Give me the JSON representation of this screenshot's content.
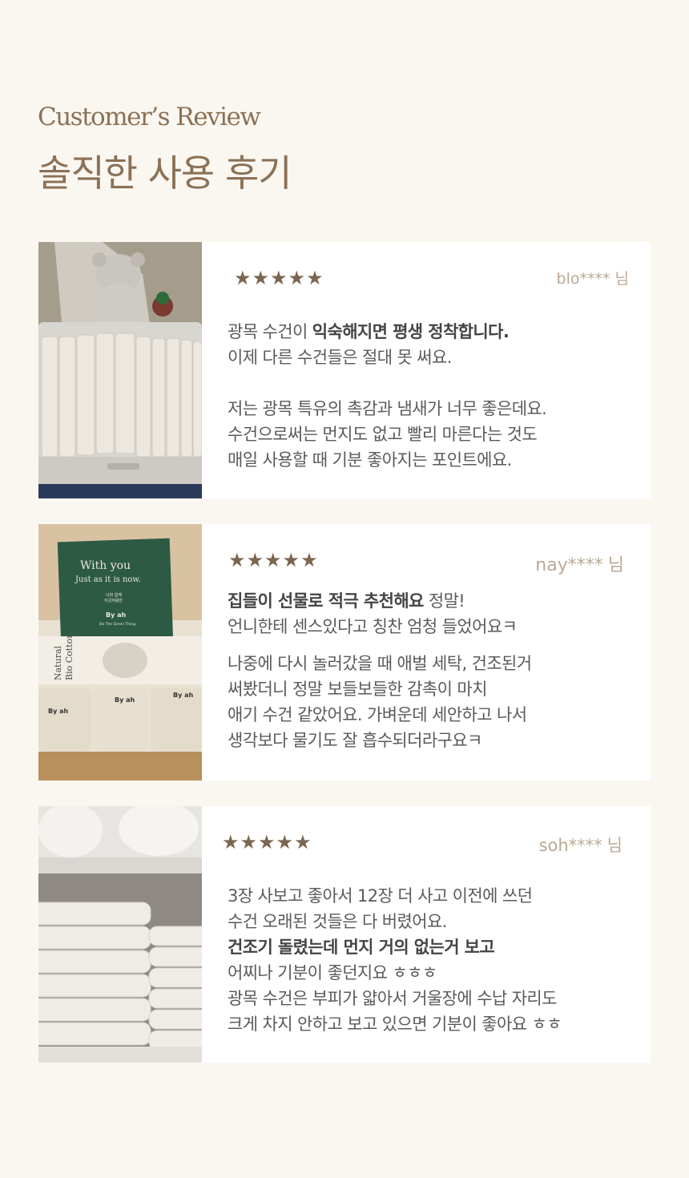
{
  "header": {
    "eyebrow": "Customer’s Review",
    "title": "솔직한 사용 후기"
  },
  "colors": {
    "accent": "#8b7155",
    "star": "#7c6650",
    "background": "#faf7f1"
  },
  "reviews": [
    {
      "stars": "★★★★★",
      "rating": 5,
      "user": "blo****",
      "suffix": "님",
      "lines": [
        {
          "bold": "광목 수건이 익숙해지면 평생 정착합니다.",
          "text": ""
        },
        {
          "text": "이제 다른 수건들은 절대 못 써요."
        },
        {
          "text": "저는 광목 특유의 촉감과 냄새가 너무 좋은데요."
        },
        {
          "text": "수건으로써는 먼지도 없고 빨리 마른다는 것도"
        },
        {
          "text": "매일 사용할 때 기분 좋아지는 포인트에요."
        }
      ],
      "lead": "광목 수건이 "
    },
    {
      "stars": "★★★★★",
      "rating": 5,
      "user": "nay****",
      "suffix": "님",
      "lines": [
        {
          "bold": "집들이 선물로 적극 추천해요",
          "text": " 정말!"
        },
        {
          "text": "언니한테 센스있다고 칭찬 엄청 들었어요ㅋ"
        },
        {
          "text": "나중에 다시 놀러갔을 때 애벌 세탁, 건조된거"
        },
        {
          "text": "써봤더니 정말 보들보들한 감촉이 마치"
        },
        {
          "text": "애기 수건 같았어요. 가벼운데 세안하고 나서"
        },
        {
          "text": "생각보다 물기도 잘 흡수되더라구요ㅋ"
        }
      ],
      "photo_text": {
        "card_line1": "With you",
        "card_line2": "Just as it is now.",
        "card_small1": "너와 함께",
        "card_small2": "지금처럼만",
        "brand": "By ah",
        "brand_tag": "Do The Green Thing",
        "label1": "Natural",
        "label2": "Bio Cotton"
      }
    },
    {
      "stars": "★★★★★",
      "rating": 5,
      "user": "soh****",
      "suffix": "님",
      "lines": [
        {
          "text": "3장 사보고 좋아서 12장 더 사고 이전에 쓰던"
        },
        {
          "text": "수건 오래된 것들은 다 버렸어요."
        },
        {
          "bold": "건조기 돌렸는데 먼지 거의 없는거 보고",
          "text": ""
        },
        {
          "text": "어찌나 기분이 좋던지요 ㅎㅎㅎ"
        },
        {
          "text": "광목 수건은 부피가 얇아서 거울장에 수납 자리도"
        },
        {
          "text": "크게 차지 안하고 보고 있으면 기분이 좋아요 ㅎㅎ"
        }
      ]
    }
  ]
}
